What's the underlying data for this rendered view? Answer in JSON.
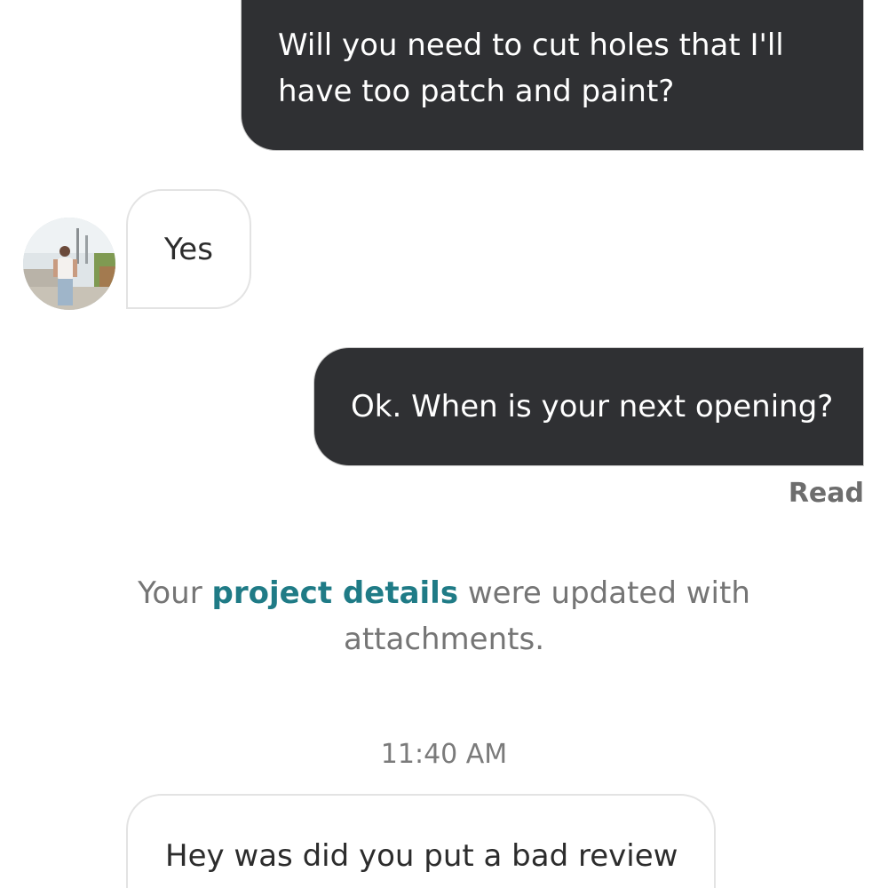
{
  "messages": {
    "outgoing_1": "Will you need to cut holes that I'll have too patch and paint?",
    "incoming_1": "Yes",
    "outgoing_2": "Ok. When is your next opening?",
    "incoming_2": "Hey was did you put a bad review"
  },
  "read_receipt": "Read",
  "system_notice": {
    "prefix": "Your ",
    "link_text": "project details",
    "suffix": " were updated with attachments."
  },
  "timestamp": "11:40 AM",
  "colors": {
    "outgoing_bubble": "#2f3033",
    "link": "#1f7b86",
    "muted_text": "#757575"
  }
}
